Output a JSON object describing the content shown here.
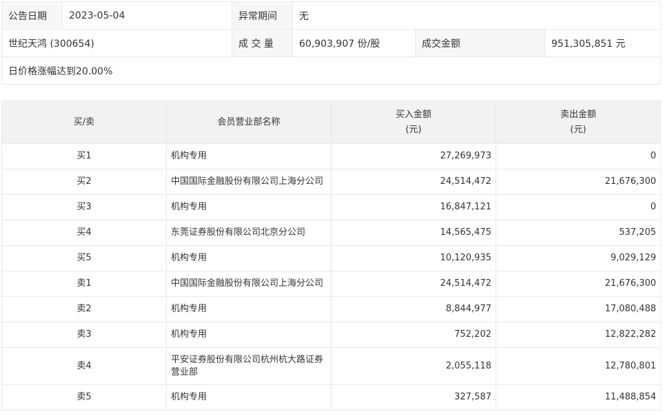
{
  "summary": {
    "announce_date_label": "公告日期",
    "announce_date": "2023-05-04",
    "abnormal_period_label": "异常期间",
    "abnormal_period": "无",
    "stock": "世纪天鸿 (300654)",
    "volume_label": "成 交 量",
    "volume": "60,903,907 份/股",
    "turnover_label": "成交金额",
    "turnover": "951,305,851 元",
    "reason": "日价格涨幅达到20.00%"
  },
  "table": {
    "headers": {
      "side": "买/卖",
      "branch": "会员营业部名称",
      "buy_line1": "买入金额",
      "buy_line2": "(元)",
      "sell_line1": "卖出金额",
      "sell_line2": "(元)"
    },
    "rows": [
      {
        "side": "买1",
        "branch": "机构专用",
        "buy": "27,269,973",
        "sell": "0"
      },
      {
        "side": "买2",
        "branch": "中国国际金融股份有限公司上海分公司",
        "buy": "24,514,472",
        "sell": "21,676,300"
      },
      {
        "side": "买3",
        "branch": "机构专用",
        "buy": "16,847,121",
        "sell": "0"
      },
      {
        "side": "买4",
        "branch": "东莞证券股份有限公司北京分公司",
        "buy": "14,565,475",
        "sell": "537,205"
      },
      {
        "side": "买5",
        "branch": "机构专用",
        "buy": "10,120,935",
        "sell": "9,029,129"
      },
      {
        "side": "卖1",
        "branch": "中国国际金融股份有限公司上海分公司",
        "buy": "24,514,472",
        "sell": "21,676,300"
      },
      {
        "side": "卖2",
        "branch": "机构专用",
        "buy": "8,844,977",
        "sell": "17,080,488"
      },
      {
        "side": "卖3",
        "branch": "机构专用",
        "buy": "752,202",
        "sell": "12,822,282"
      },
      {
        "side": "卖4",
        "branch": "平安证券股份有限公司杭州杭大路证券营业部",
        "buy": "2,055,118",
        "sell": "12,780,801"
      },
      {
        "side": "卖5",
        "branch": "机构专用",
        "buy": "327,587",
        "sell": "11,488,854"
      }
    ]
  }
}
